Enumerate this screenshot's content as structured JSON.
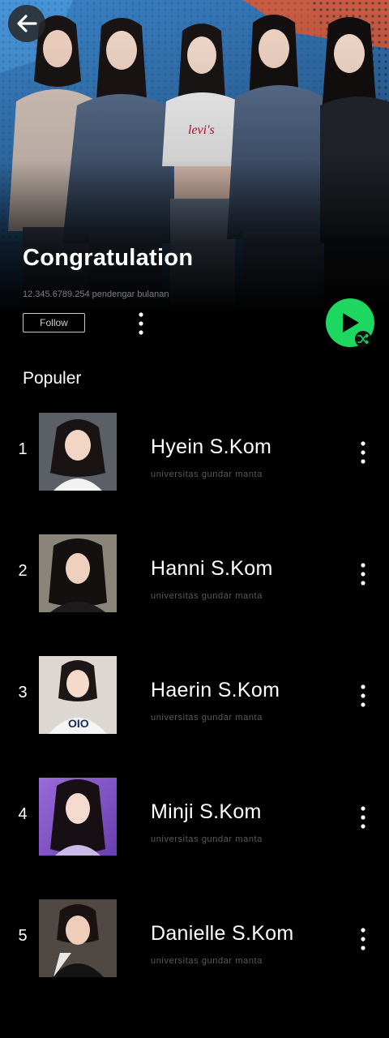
{
  "header": {
    "artist_name": "Congratulation",
    "listeners": "12.345.6789.254 pendengar bulanan",
    "follow_label": "Follow"
  },
  "section": {
    "title": "Populer"
  },
  "tracks": [
    {
      "rank": "1",
      "name": "Hyein S.Kom",
      "subtitle": "universitas gundar manta"
    },
    {
      "rank": "2",
      "name": "Hanni S.Kom",
      "subtitle": "universitas gundar manta"
    },
    {
      "rank": "3",
      "name": "Haerin S.Kom",
      "subtitle": "universitas gundar manta"
    },
    {
      "rank": "4",
      "name": "Minji S.Kom",
      "subtitle": "universitas gundar manta"
    },
    {
      "rank": "5",
      "name": "Danielle S.Kom",
      "subtitle": "universitas gundar manta"
    }
  ],
  "colors": {
    "accent": "#1ed760",
    "background": "#000000",
    "subtext": "#5a5a5a"
  },
  "icons": {
    "back": "arrow-left-icon",
    "more": "more-vertical-icon",
    "play": "play-icon",
    "shuffle": "shuffle-icon"
  }
}
